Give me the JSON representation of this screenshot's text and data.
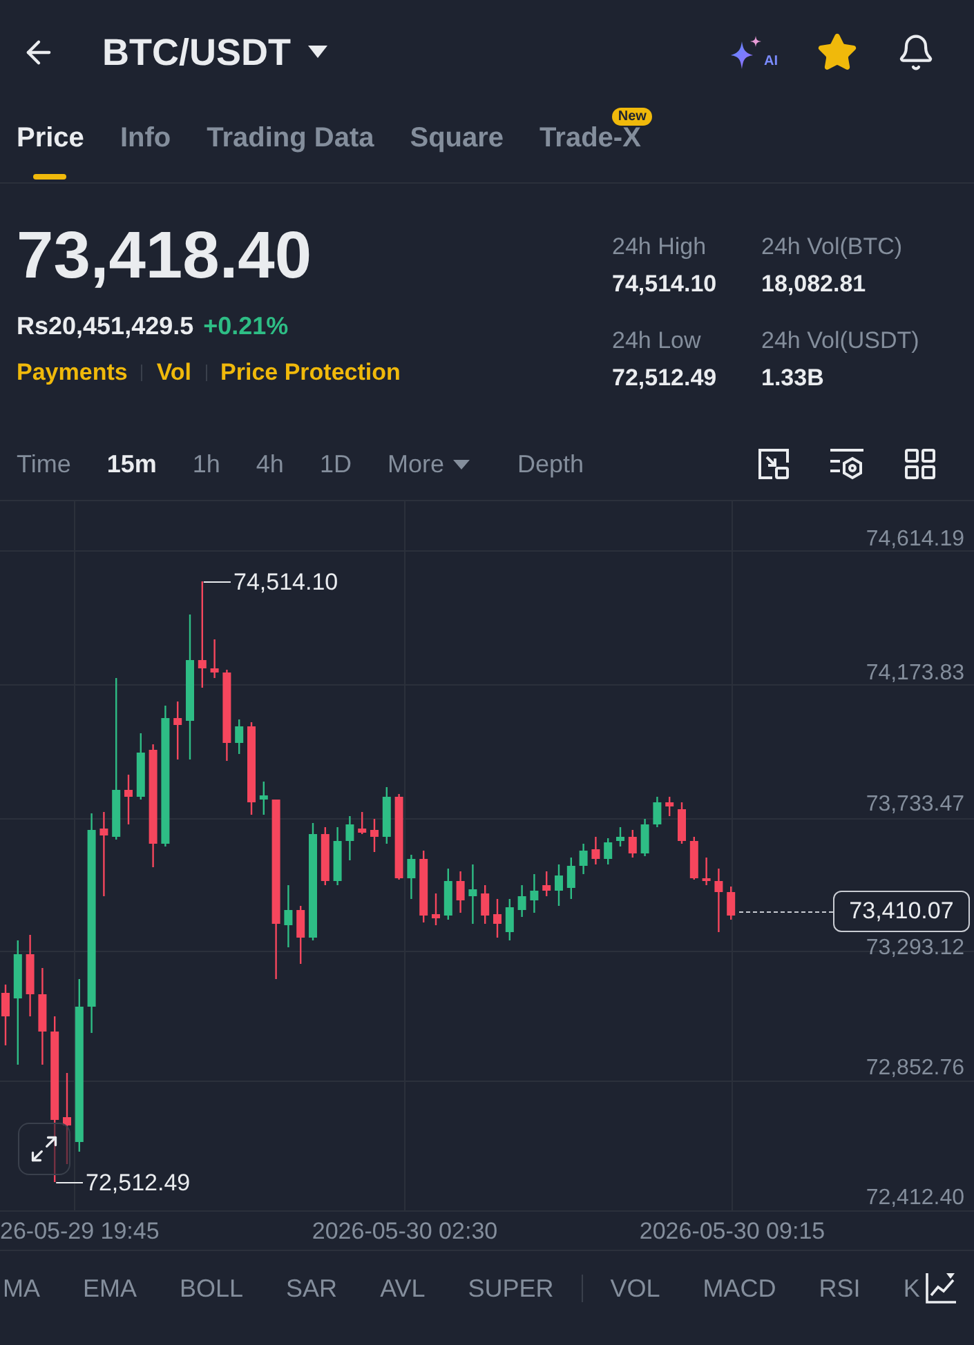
{
  "header": {
    "title": "BTC/USDT",
    "ai_label": "AI",
    "favorite": true
  },
  "tabs": [
    {
      "label": "Price",
      "selected": true
    },
    {
      "label": "Info",
      "selected": false
    },
    {
      "label": "Trading Data",
      "selected": false
    },
    {
      "label": "Square",
      "selected": false
    },
    {
      "label": "Trade-X",
      "selected": false,
      "badge": "New"
    }
  ],
  "ticker": {
    "price": "73,418.40",
    "fiat_price": "Rs20,451,429.5",
    "change": "+0.21%",
    "links": [
      "Payments",
      "Vol",
      "Price Protection"
    ]
  },
  "stats": [
    {
      "label": "24h High",
      "value": "74,514.10"
    },
    {
      "label": "24h Vol(BTC)",
      "value": "18,082.81"
    },
    {
      "label": "24h Low",
      "value": "72,512.49"
    },
    {
      "label": "24h Vol(USDT)",
      "value": "1.33B"
    }
  ],
  "intervals": [
    {
      "label": "Time",
      "kind": "option",
      "selected": false
    },
    {
      "label": "15m",
      "kind": "option",
      "selected": true
    },
    {
      "label": "1h",
      "kind": "option",
      "selected": false
    },
    {
      "label": "4h",
      "kind": "option",
      "selected": false
    },
    {
      "label": "1D",
      "kind": "option",
      "selected": false
    },
    {
      "label": "More",
      "kind": "menu",
      "selected": false
    },
    {
      "label": "Depth",
      "kind": "view",
      "selected": false
    }
  ],
  "chart": {
    "price_axis": [
      "74,614.19",
      "74,173.83",
      "73,733.47",
      "73,293.12",
      "72,852.76",
      "72,412.40"
    ],
    "time_axis": [
      "26-05-29 19:45",
      "2026-05-30 02:30",
      "2026-05-30 09:15"
    ],
    "high_label": "74,514.10",
    "low_label": "72,512.49",
    "last_price": "73,410.07"
  },
  "indicators": {
    "main": [
      "MA",
      "EMA",
      "BOLL",
      "SAR",
      "AVL",
      "SUPER"
    ],
    "sub": [
      "VOL",
      "MACD",
      "RSI",
      "K"
    ]
  }
}
